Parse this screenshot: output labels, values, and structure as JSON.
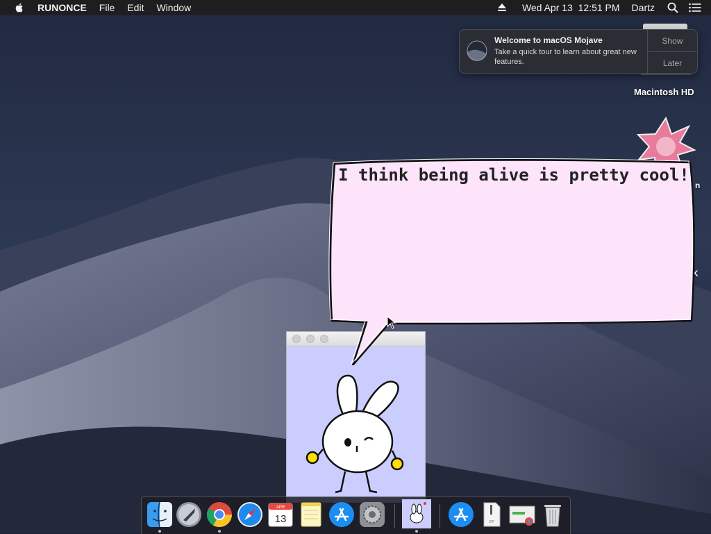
{
  "menubar": {
    "app_name": "RUNONCE",
    "menus": [
      "File",
      "Edit",
      "Window"
    ],
    "clock": "Wed Apr 13  12:51 PM",
    "user": "Dartz"
  },
  "notification": {
    "title": "Welcome to macOS Mojave",
    "body": "Take a quick tour to learn about great new features.",
    "show_label": "Show",
    "later_label": "Later"
  },
  "desktop_icons": {
    "hd_label": "Macintosh HD",
    "partial_label_1": "n",
    "partial_label_2": "K"
  },
  "bubble": {
    "text": "I think being alive is pretty cool!"
  },
  "dock": {
    "items": [
      "Finder",
      "Launchpad",
      "Google Chrome",
      "Safari",
      "Calendar",
      "Notes",
      "App Store",
      "System Preferences",
      "RUNONCE",
      "App Store",
      "Archive",
      "Chrome App",
      "Trash"
    ],
    "calendar": {
      "month": "APR",
      "day": "13"
    }
  },
  "colors": {
    "bubble_fill": "#fde4fb",
    "buddy_bg": "#cacdfd",
    "button_yellow": "#ffdf00"
  }
}
